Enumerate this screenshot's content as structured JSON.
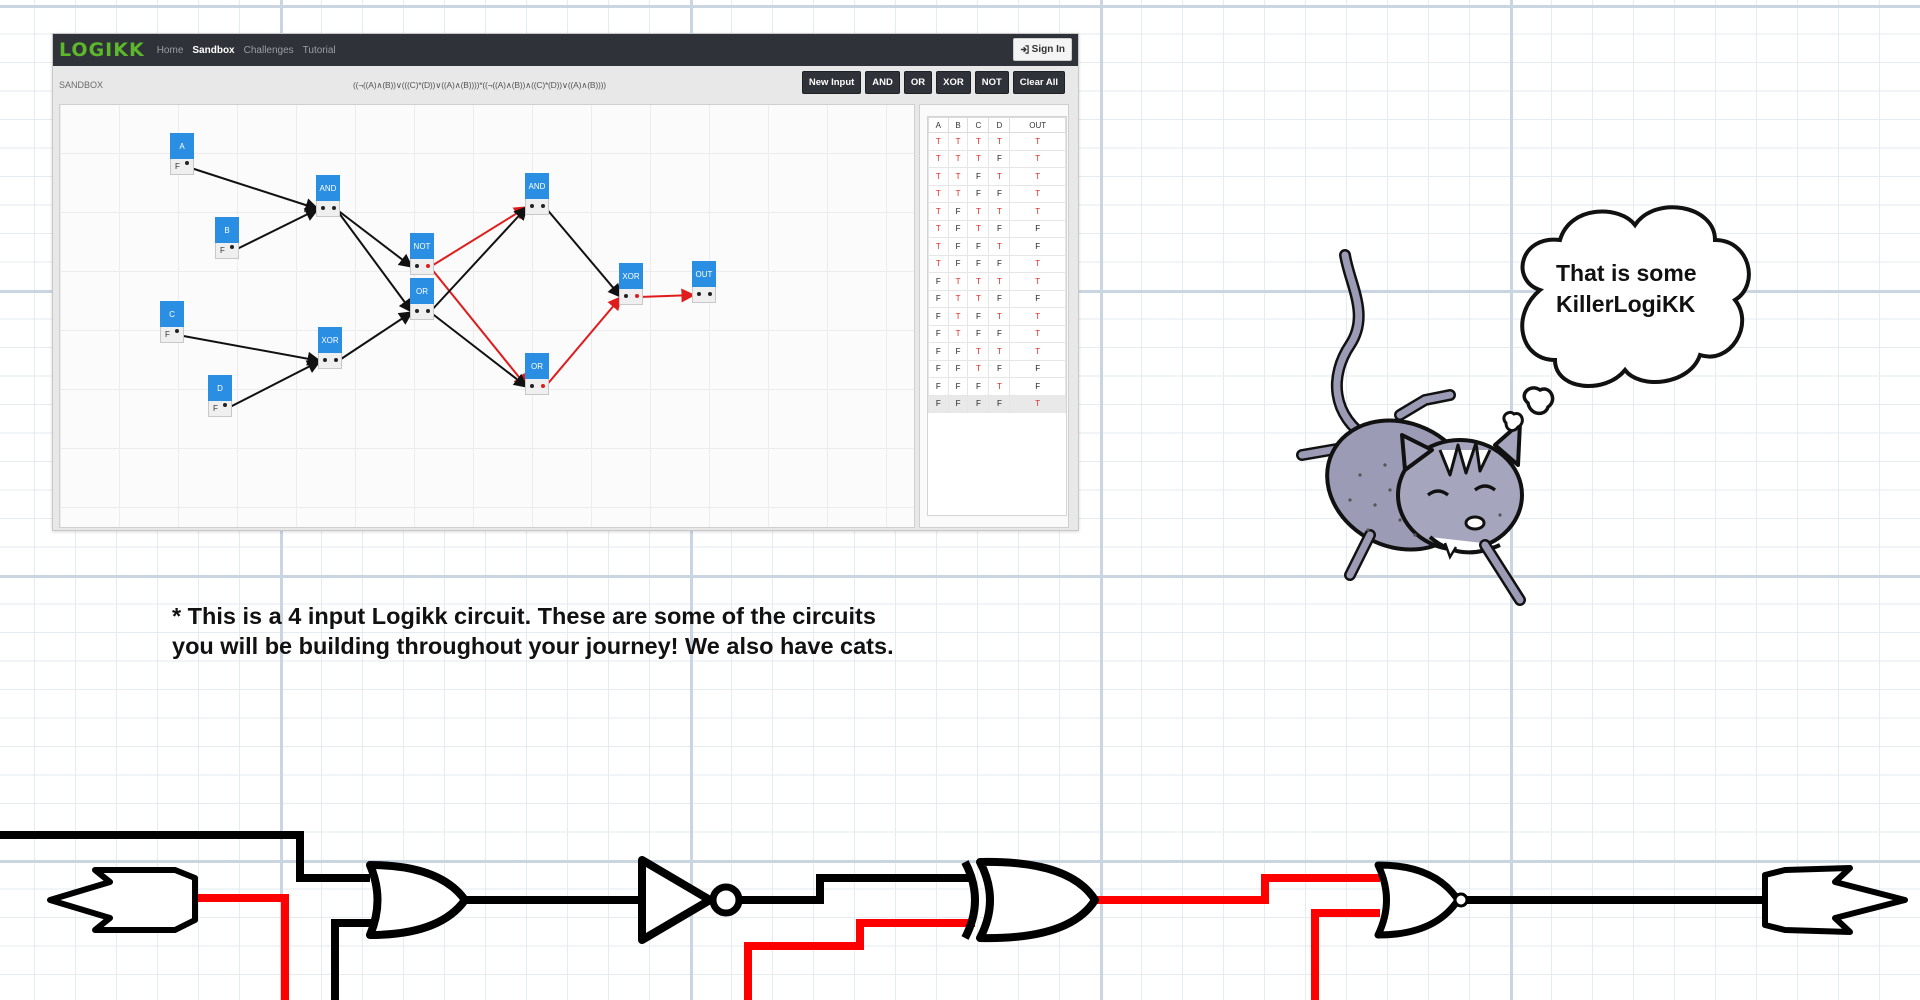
{
  "app": {
    "logo": "LOGIKK",
    "nav": [
      "Home",
      "Sandbox",
      "Challenges",
      "Tutorial"
    ],
    "active_nav": "Sandbox",
    "signin_label": "Sign In",
    "sandbox_label": "SANDBOX",
    "expression": "((¬((A)∧(B))∨(((C)*(D))∨((A)∧(B))))*((¬((A)∧(B))∧((C)*(D))∨((A)∧(B))))",
    "toolbar": [
      "New Input",
      "AND",
      "OR",
      "XOR",
      "NOT",
      "Clear All"
    ],
    "nodes": [
      {
        "id": "A",
        "label": "A",
        "value": "F",
        "dot": "black"
      },
      {
        "id": "B",
        "label": "B",
        "value": "F",
        "dot": "black"
      },
      {
        "id": "C",
        "label": "C",
        "value": "F",
        "dot": "black"
      },
      {
        "id": "D",
        "label": "D",
        "value": "F",
        "dot": "black"
      },
      {
        "id": "AND1",
        "label": "AND",
        "value": "",
        "dot": "black"
      },
      {
        "id": "XOR1",
        "label": "XOR",
        "value": "",
        "dot": "black"
      },
      {
        "id": "NOT1",
        "label": "NOT",
        "value": "",
        "dot": "red"
      },
      {
        "id": "OR1",
        "label": "OR",
        "value": "",
        "dot": "black"
      },
      {
        "id": "AND2",
        "label": "AND",
        "value": "",
        "dot": "black"
      },
      {
        "id": "OR2",
        "label": "OR",
        "value": "",
        "dot": "red"
      },
      {
        "id": "XOR2",
        "label": "XOR",
        "value": "",
        "dot": "red"
      },
      {
        "id": "OUT",
        "label": "OUT",
        "value": "",
        "dot": "black"
      }
    ],
    "wires": [
      {
        "from": "A",
        "to": "AND1",
        "active": false
      },
      {
        "from": "B",
        "to": "AND1",
        "active": false
      },
      {
        "from": "C",
        "to": "XOR1",
        "active": false
      },
      {
        "from": "D",
        "to": "XOR1",
        "active": false
      },
      {
        "from": "AND1",
        "to": "NOT1",
        "active": false
      },
      {
        "from": "AND1",
        "to": "OR1",
        "active": false
      },
      {
        "from": "XOR1",
        "to": "OR1",
        "active": false
      },
      {
        "from": "NOT1",
        "to": "AND2",
        "active": true
      },
      {
        "from": "NOT1",
        "to": "OR2",
        "active": true
      },
      {
        "from": "OR1",
        "to": "AND2",
        "active": false
      },
      {
        "from": "OR1",
        "to": "OR2",
        "active": false
      },
      {
        "from": "AND2",
        "to": "XOR2",
        "active": false
      },
      {
        "from": "OR2",
        "to": "XOR2",
        "active": true
      },
      {
        "from": "XOR2",
        "to": "OUT",
        "active": true
      }
    ],
    "truth_table": {
      "headers": [
        "A",
        "B",
        "C",
        "D",
        "OUT"
      ],
      "rows": [
        [
          "T",
          "T",
          "T",
          "T",
          "T"
        ],
        [
          "T",
          "T",
          "T",
          "F",
          "T"
        ],
        [
          "T",
          "T",
          "F",
          "T",
          "T"
        ],
        [
          "T",
          "T",
          "F",
          "F",
          "T"
        ],
        [
          "T",
          "F",
          "T",
          "T",
          "T"
        ],
        [
          "T",
          "F",
          "T",
          "F",
          "F"
        ],
        [
          "T",
          "F",
          "F",
          "T",
          "F"
        ],
        [
          "T",
          "F",
          "F",
          "F",
          "T"
        ],
        [
          "F",
          "T",
          "T",
          "T",
          "T"
        ],
        [
          "F",
          "T",
          "T",
          "F",
          "F"
        ],
        [
          "F",
          "T",
          "F",
          "T",
          "T"
        ],
        [
          "F",
          "T",
          "F",
          "F",
          "T"
        ],
        [
          "F",
          "F",
          "T",
          "T",
          "T"
        ],
        [
          "F",
          "F",
          "T",
          "F",
          "F"
        ],
        [
          "F",
          "F",
          "F",
          "T",
          "F"
        ],
        [
          "F",
          "F",
          "F",
          "F",
          "T"
        ]
      ]
    }
  },
  "caption": {
    "line1": "* This is a 4 input Logikk circuit. These are some of the circuits",
    "line2": "you will be building throughout your journey! We also have cats."
  },
  "thought_bubble": {
    "line1": "That is some",
    "line2": "KillerLogiKK"
  },
  "colors": {
    "navbar": "#2f3238",
    "logo": "#5cb82a",
    "node": "#2a8ee3",
    "active_wire": "#e01b1b",
    "true_value": "#e0281f",
    "cat_body": "#9b9bb5"
  },
  "icons": {
    "signin": "sign-in-icon",
    "cat": "cat-illustration",
    "bubble": "thought-bubble-icon"
  }
}
